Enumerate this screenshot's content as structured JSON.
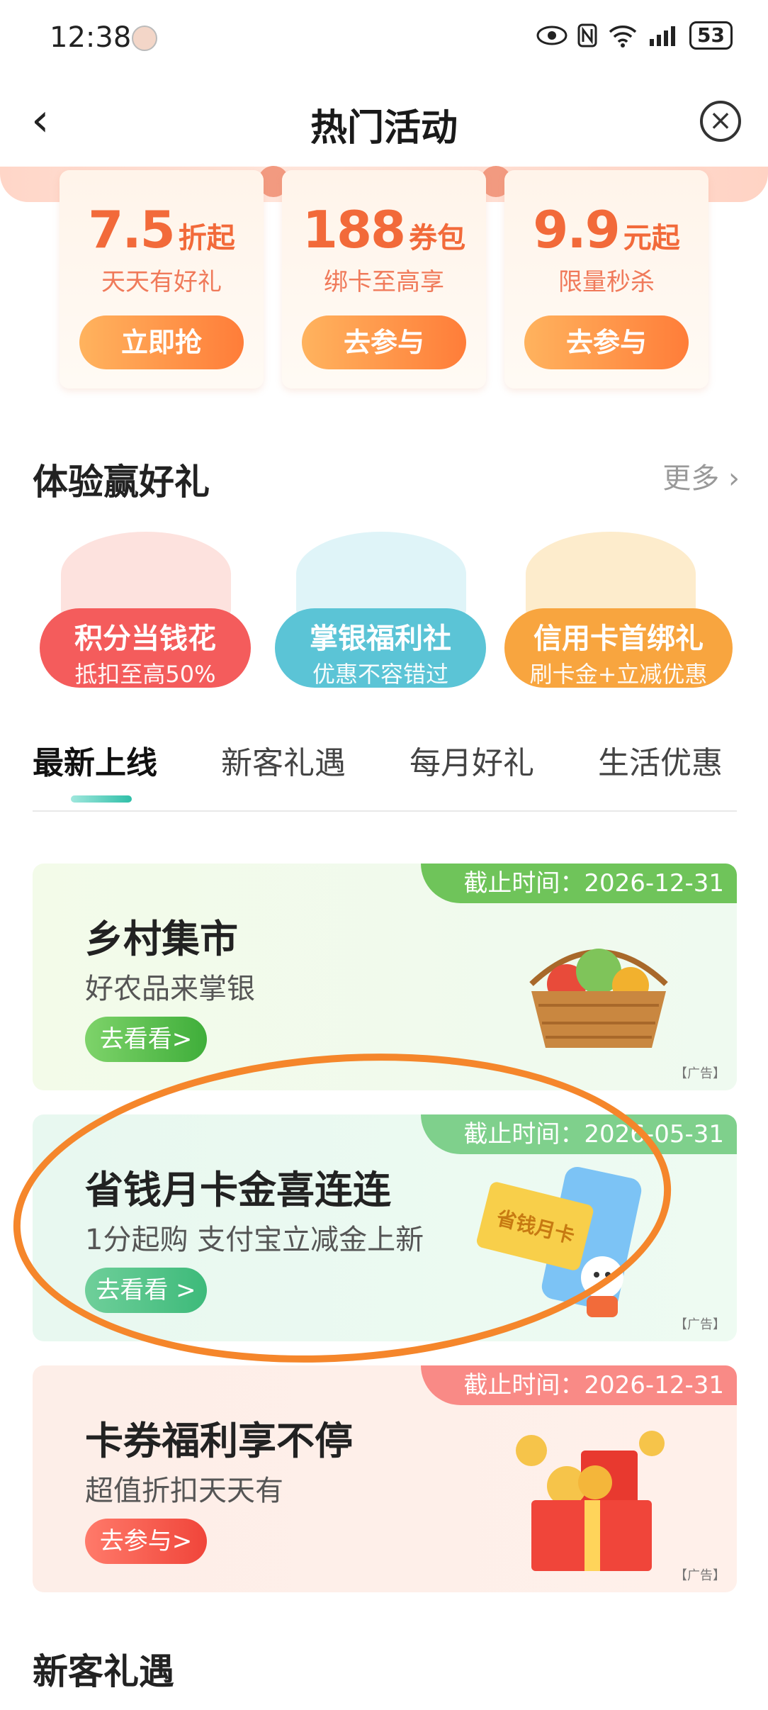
{
  "status_bar": {
    "time": "12:38",
    "battery": "53",
    "signal_label": "6"
  },
  "header": {
    "title": "热门活动",
    "back_glyph": "‹",
    "close_glyph": "×"
  },
  "promos": [
    {
      "big": "7.5",
      "unit": "折起",
      "sub": "天天有好礼",
      "button": "立即抢"
    },
    {
      "big": "188",
      "unit": "券包",
      "sub": "绑卡至高享",
      "button": "去参与"
    },
    {
      "big": "9.9",
      "unit": "元起",
      "sub": "限量秒杀",
      "button": "去参与"
    }
  ],
  "experience": {
    "title": "体验赢好礼",
    "more": "更多",
    "items": [
      {
        "title": "积分当钱花",
        "sub": "抵扣至高50%",
        "color": "#f45c5c"
      },
      {
        "title": "掌银福利社",
        "sub": "优惠不容错过",
        "color": "#5bc4d6"
      },
      {
        "title": "信用卡首绑礼",
        "sub": "刷卡金+立减优惠",
        "color": "#f8a53f"
      }
    ]
  },
  "tabs": [
    "最新上线",
    "新客礼遇",
    "每月好礼",
    "生活优惠"
  ],
  "cards": [
    {
      "deadline": "截止时间：2026-12-31",
      "title": "乡村集市",
      "desc": "好农品来掌银",
      "button": "去看看>",
      "ad": "【广告】"
    },
    {
      "deadline": "截止时间：2026-05-31",
      "title": "省钱月卡金喜连连",
      "desc": "1分起购 支付宝立减金上新",
      "button": "去看看 >",
      "ad": "【广告】",
      "art_text": "省钱月卡"
    },
    {
      "deadline": "截止时间：2026-12-31",
      "title": "卡券福利享不停",
      "desc": "超值折扣天天有",
      "button": "去参与>",
      "ad": "【广告】"
    }
  ],
  "bottom_section": {
    "title": "新客礼遇"
  }
}
